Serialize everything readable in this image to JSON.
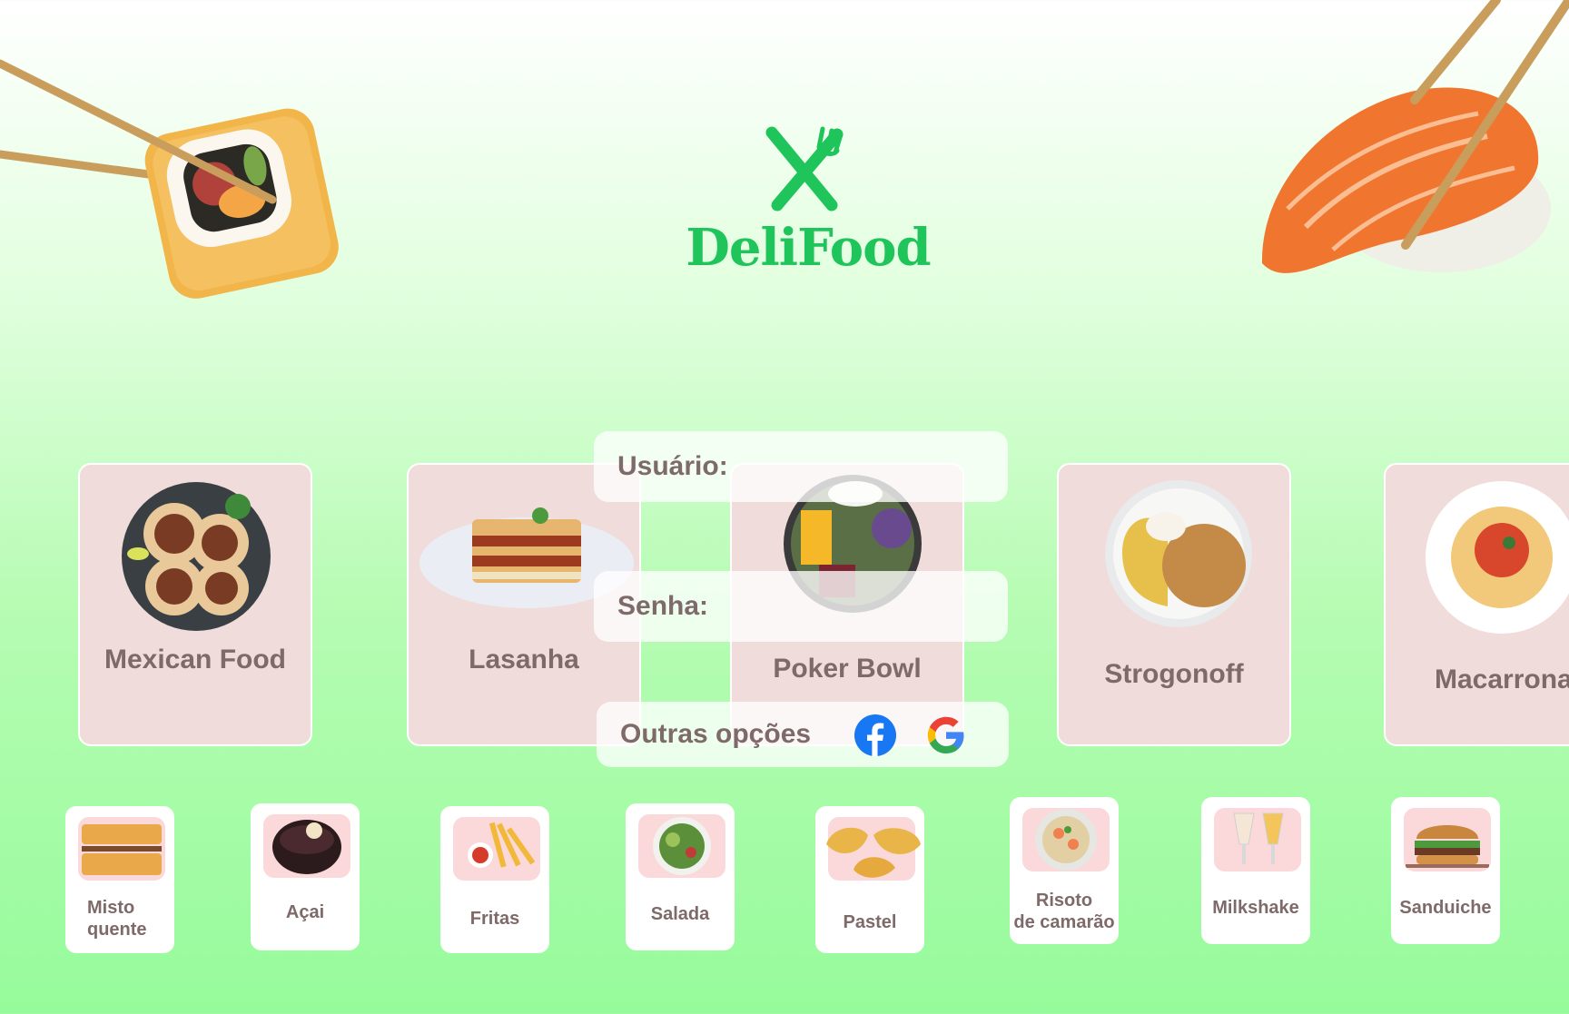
{
  "app": {
    "name": "DeliFood"
  },
  "colors": {
    "brand": "#1fc45a",
    "card": "#f0dcdb",
    "label": "#7e6a68",
    "thumb": "#fbd9da"
  },
  "featured": [
    {
      "name": "Mexican Food"
    },
    {
      "name": "Lasanha"
    },
    {
      "name": "Poker Bowl"
    },
    {
      "name": "Strogonoff"
    },
    {
      "name": "Macarrona"
    }
  ],
  "login": {
    "user_label": "Usuário:",
    "password_label": "Senha:",
    "other_options_label": "Outras opções",
    "social": [
      "facebook-icon",
      "google-icon"
    ]
  },
  "categories": [
    {
      "line1": "Misto",
      "line2": "quente"
    },
    {
      "line1": "Açai",
      "line2": ""
    },
    {
      "line1": "Fritas",
      "line2": ""
    },
    {
      "line1": "Salada",
      "line2": ""
    },
    {
      "line1": "Pastel",
      "line2": ""
    },
    {
      "line1": "Risoto",
      "line2": "de camarão"
    },
    {
      "line1": "Milkshake",
      "line2": ""
    },
    {
      "line1": "Sanduiche",
      "line2": ""
    }
  ]
}
